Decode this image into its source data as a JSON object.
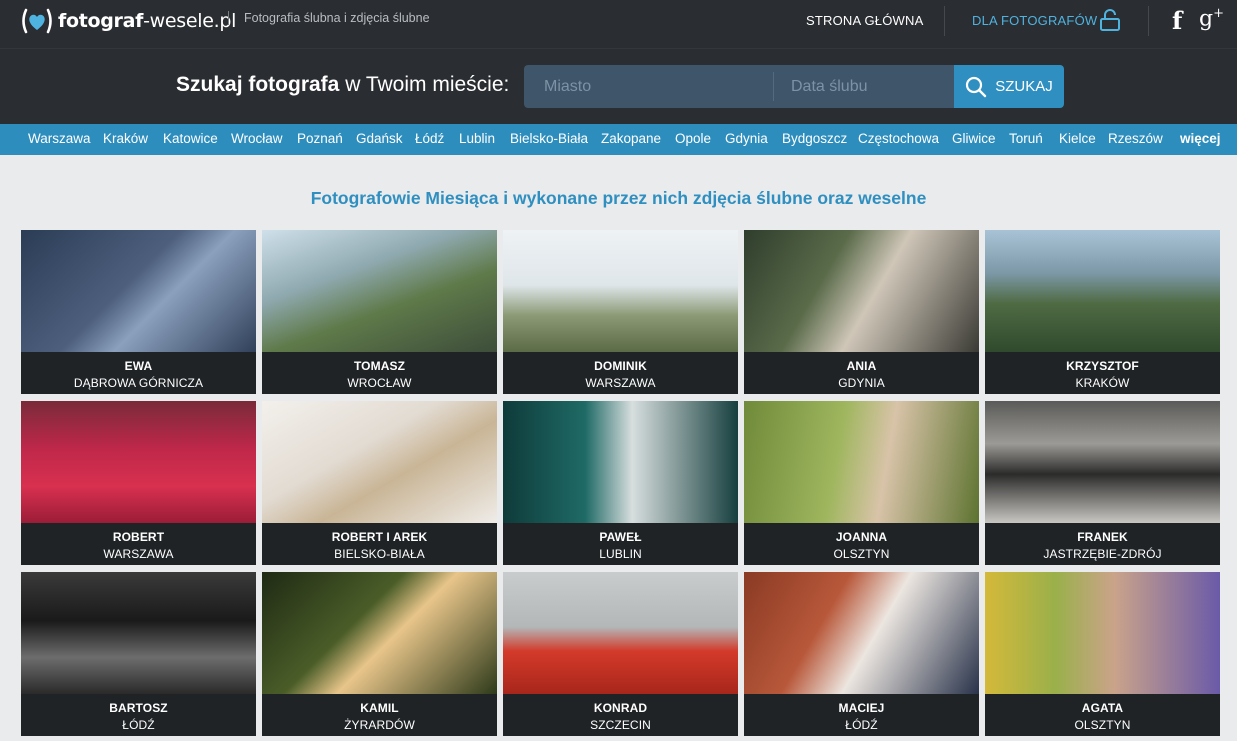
{
  "header": {
    "logo_bold": "fotograf",
    "logo_rest": "-wesele.pl",
    "tagline": "Fotografia ślubna i zdjęcia ślubne",
    "nav_home": "STRONA GŁÓWNA",
    "nav_photographers": "DLA FOTOGRAFÓW",
    "facebook_glyph": "f",
    "gplus_glyph": "g",
    "gplus_sup": "+",
    "icons": [
      "heart-bracket-logo-icon",
      "lock-icon",
      "facebook-icon",
      "google-plus-icon"
    ]
  },
  "search": {
    "title_bold": "Szukaj fotografa",
    "title_rest": " w Twoim mieście:",
    "city_placeholder": "Miasto",
    "date_placeholder": "Data ślubu",
    "button_label": "SZUKAJ",
    "button_icon": "search-icon"
  },
  "cities": [
    "Warszawa",
    "Kraków",
    "Katowice",
    "Wrocław",
    "Poznań",
    "Gdańsk",
    "Łódź",
    "Lublin",
    "Bielsko-Biała",
    "Zakopane",
    "Opole",
    "Gdynia",
    "Bydgoszcz",
    "Częstochowa",
    "Gliwice",
    "Toruń",
    "Kielce",
    "Rzeszów"
  ],
  "cities_more": "więcej",
  "heading": "Fotografowie Miesiąca i wykonane przez nich zdjęcia ślubne oraz weselne",
  "photographers": [
    {
      "name": "EWA",
      "city": "DĄBROWA GÓRNICZA"
    },
    {
      "name": "TOMASZ",
      "city": "WROCŁAW"
    },
    {
      "name": "DOMINIK",
      "city": "WARSZAWA"
    },
    {
      "name": "ANIA",
      "city": "GDYNIA"
    },
    {
      "name": "KRZYSZTOF",
      "city": "KRAKÓW"
    },
    {
      "name": "ROBERT",
      "city": "WARSZAWA"
    },
    {
      "name": "ROBERT I AREK",
      "city": "BIELSKO-BIAŁA"
    },
    {
      "name": "PAWEŁ",
      "city": "LUBLIN"
    },
    {
      "name": "JOANNA",
      "city": "OLSZTYN"
    },
    {
      "name": "FRANEK",
      "city": "JASTRZĘBIE-ZDRÓJ"
    },
    {
      "name": "BARTOSZ",
      "city": "ŁÓDŹ"
    },
    {
      "name": "KAMIL",
      "city": "ŻYRARDÓW"
    },
    {
      "name": "KONRAD",
      "city": "SZCZECIN"
    },
    {
      "name": "MACIEJ",
      "city": "ŁÓDŹ"
    },
    {
      "name": "AGATA",
      "city": "OLSZTYN"
    }
  ],
  "colors": {
    "topbar": "#2a2d31",
    "accent_blue": "#2e8fc0",
    "link_blue": "#4fb3e0",
    "citybar": "#2d8dbd",
    "caption_bg": "#1f2326",
    "page_bg": "#e9ebec"
  }
}
